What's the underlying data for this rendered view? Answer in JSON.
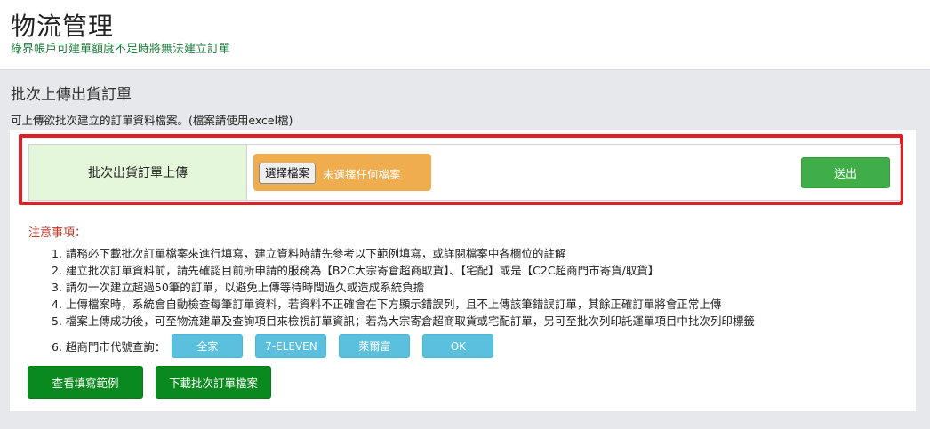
{
  "header": {
    "title": "物流管理",
    "subtitle": "綠界帳戶可建單額度不足時將無法建立訂單"
  },
  "section": {
    "title": "批次上傳出貨訂單",
    "description": "可上傳欲批次建立的訂單資料檔案。(檔案請使用excel檔)"
  },
  "upload": {
    "label": "批次出貨訂單上傳",
    "file_button": "選擇檔案",
    "file_status": "未選擇任何檔案",
    "submit": "送出"
  },
  "notice": {
    "title": "注意事項：",
    "items": [
      "1. 請務必下載批次訂單檔案來進行填寫，建立資料時請先參考以下範例填寫，或詳閱檔案中各欄位的註解",
      "2. 建立批次訂單資料前，請先確認目前所申請的服務為【B2C大宗寄倉超商取貨】、【宅配】或是【C2C超商門市寄貨/取貨】",
      "3. 請勿一次建立超過50筆的訂單，以避免上傳等待時間過久或造成系統負擔",
      "4. 上傳檔案時，系統會自動檢查每筆訂單資料，若資料不正確會在下方顯示錯誤列，且不上傳該筆錯誤訂單，其餘正確訂單將會正常上傳",
      "5. 檔案上傳成功後，可至物流建單及查詢項目來檢視訂單資訊；若為大宗寄倉超商取貨或宅配訂單，另可至批次列印託運單項目中批次列印標籤"
    ],
    "codes_label": "6. 超商門市代號查詢：",
    "code_buttons": [
      "全家",
      "7-ELEVEN",
      "萊爾富",
      "OK"
    ]
  },
  "actions": {
    "view_example": "查看填寫範例",
    "download_file": "下載批次訂單檔案"
  },
  "colors": {
    "highlight_border": "#e01e26",
    "file_box": "#f0ad4e",
    "submit": "#3fae49",
    "info_button": "#5bc0de",
    "action_button": "#0a8a1e",
    "notice_title": "#c0392b",
    "subtitle": "#1e7a3c"
  }
}
